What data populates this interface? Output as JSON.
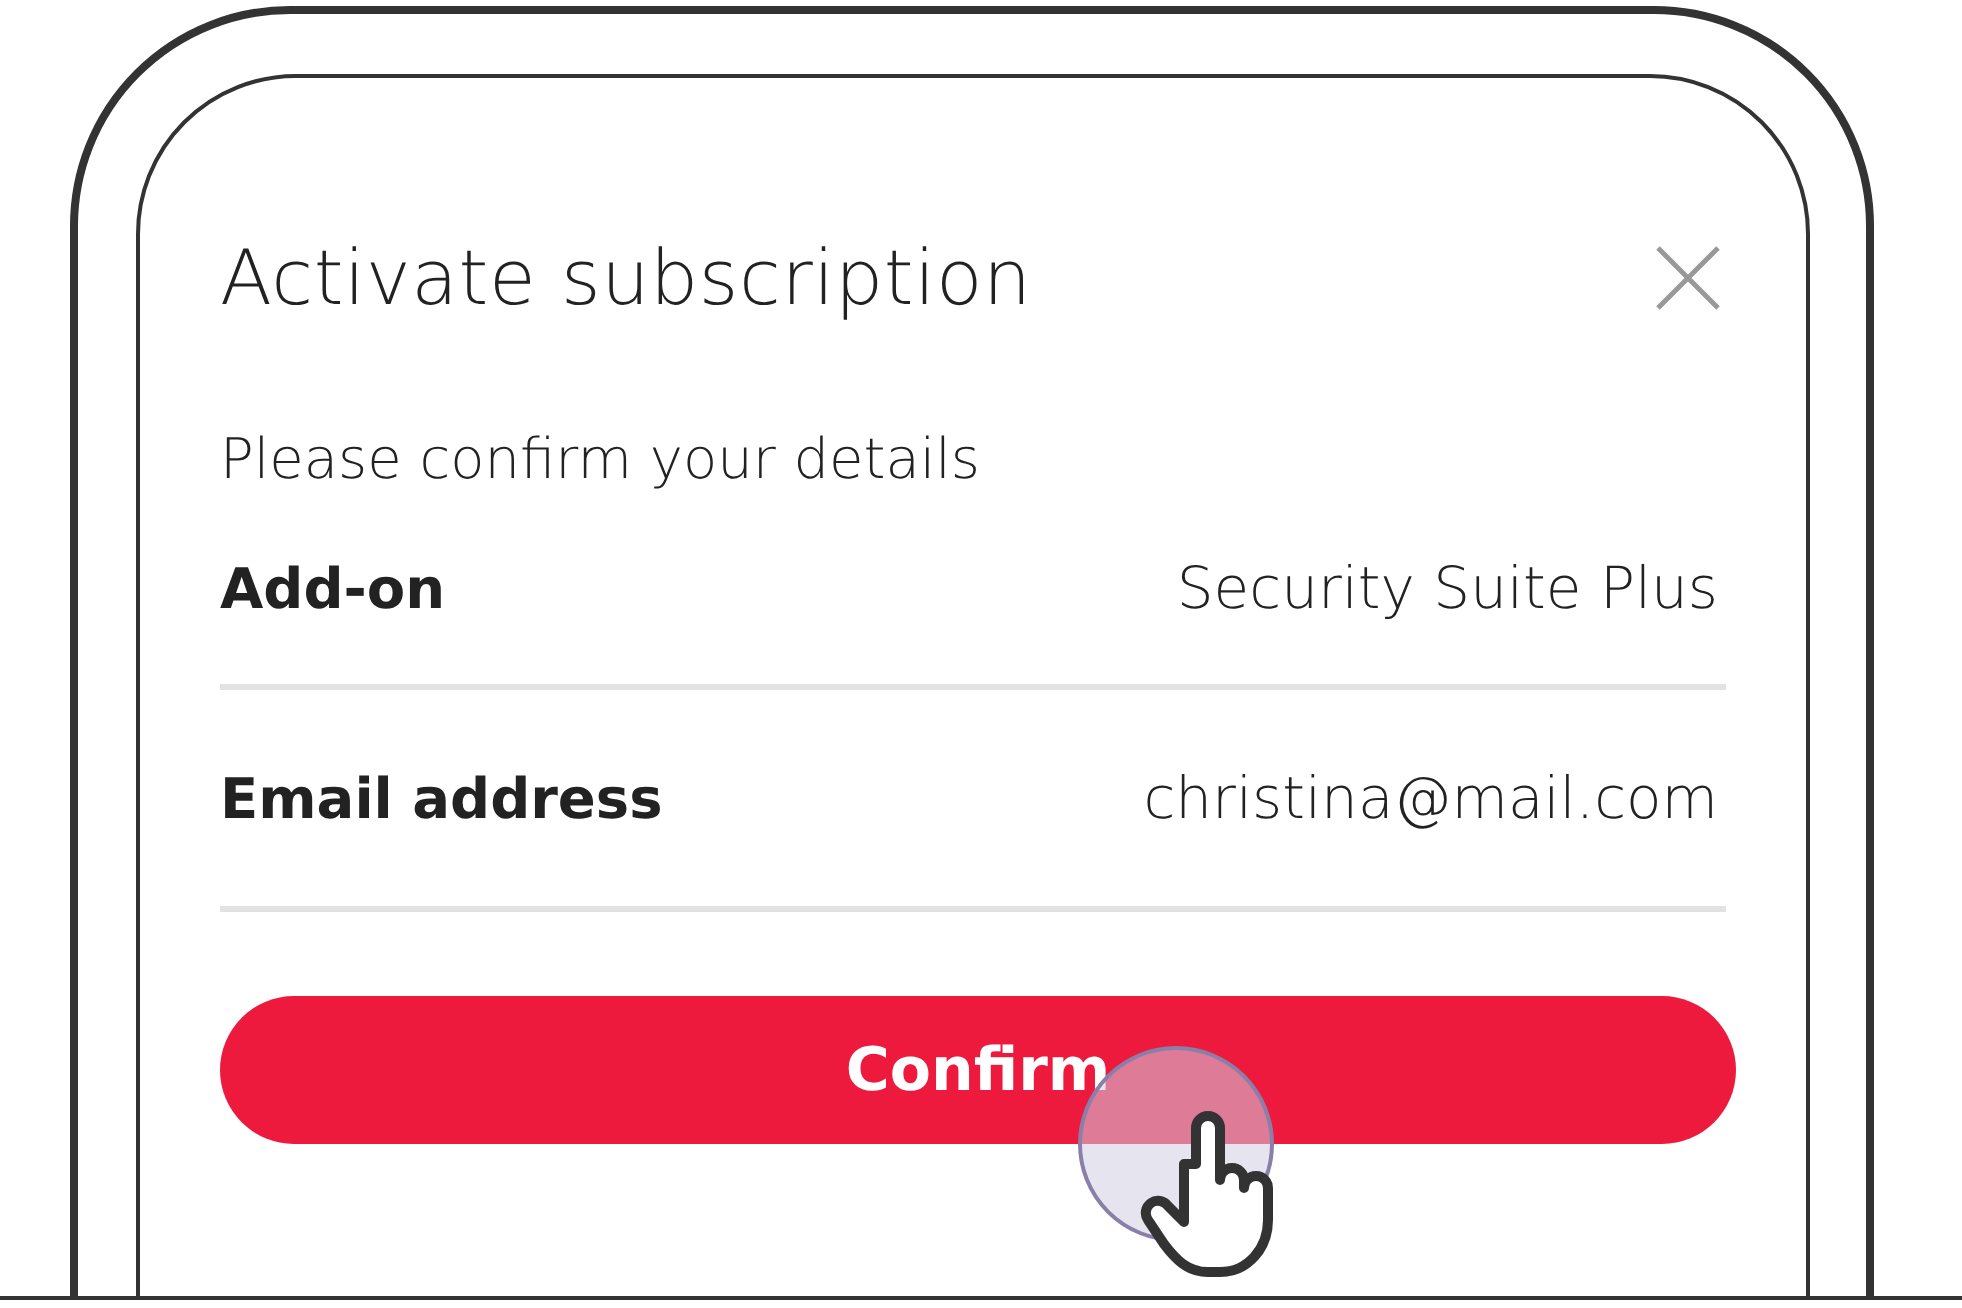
{
  "dialog": {
    "title": "Activate subscription",
    "subtitle": "Please confirm your details",
    "details": [
      {
        "label": "Add-on",
        "value": "Security Suite Plus"
      },
      {
        "label": "Email address",
        "value": "christina@mail.com"
      }
    ],
    "confirm_button": {
      "label": "Confirm"
    }
  }
}
